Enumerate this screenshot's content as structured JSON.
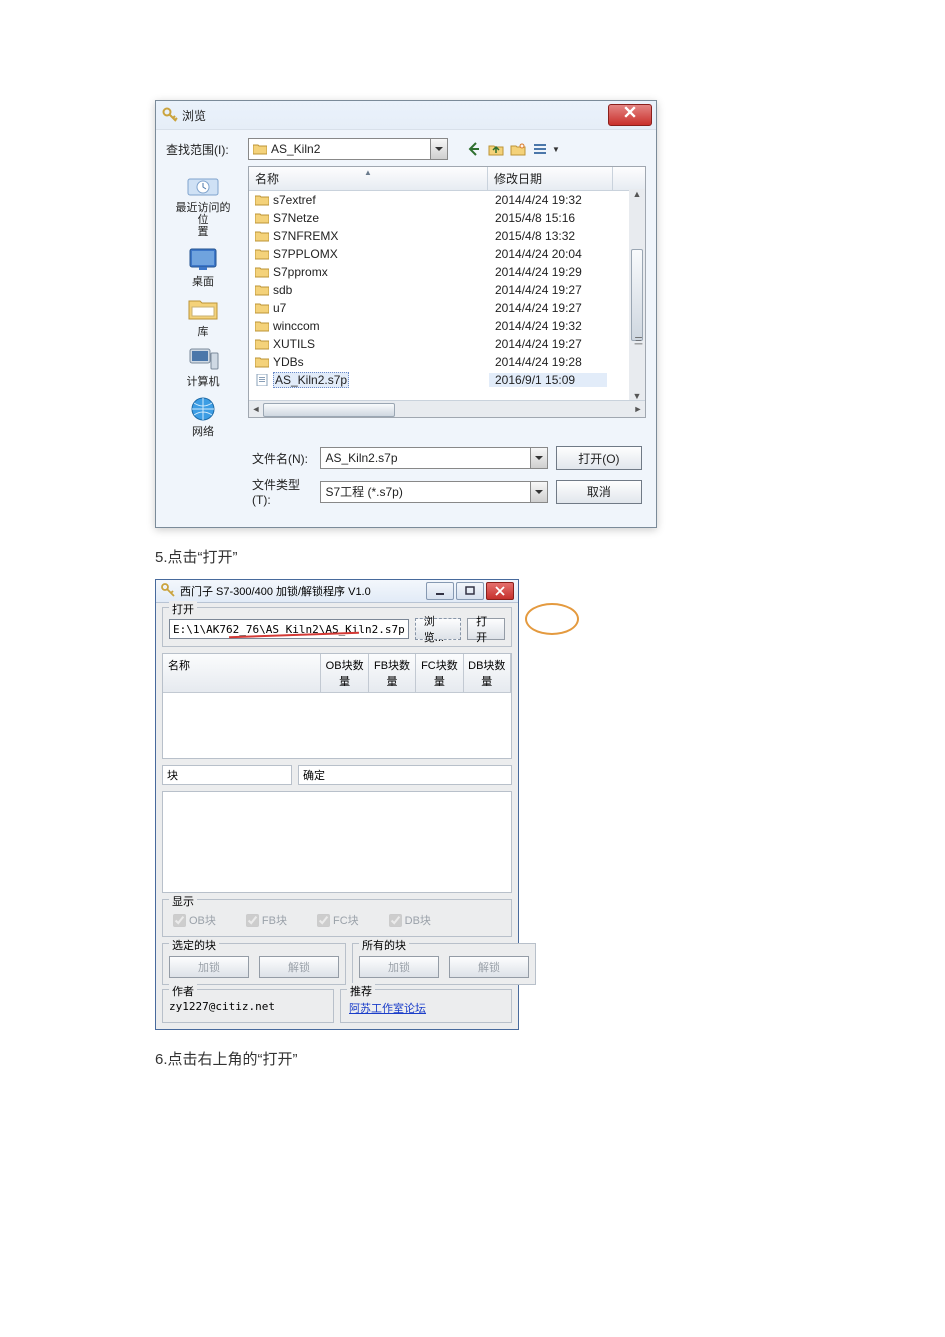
{
  "dialog1": {
    "title": "浏览",
    "look_in_label": "查找范围(I):",
    "look_in_value": "AS_Kiln2",
    "columns": {
      "name": "名称",
      "date": "修改日期"
    },
    "places": [
      {
        "label": "最近访问的位\n置"
      },
      {
        "label": "桌面"
      },
      {
        "label": "库"
      },
      {
        "label": "计算机"
      },
      {
        "label": "网络"
      }
    ],
    "files": [
      {
        "name": "s7extref",
        "date": "2014/4/24 19:32",
        "type": "folder"
      },
      {
        "name": "S7Netze",
        "date": "2015/4/8 15:16",
        "type": "folder"
      },
      {
        "name": "S7NFREMX",
        "date": "2015/4/8 13:32",
        "type": "folder"
      },
      {
        "name": "S7PPLOMX",
        "date": "2014/4/24 20:04",
        "type": "folder"
      },
      {
        "name": "S7ppromx",
        "date": "2014/4/24 19:29",
        "type": "folder"
      },
      {
        "name": "sdb",
        "date": "2014/4/24 19:27",
        "type": "folder"
      },
      {
        "name": "u7",
        "date": "2014/4/24 19:27",
        "type": "folder"
      },
      {
        "name": "winccom",
        "date": "2014/4/24 19:32",
        "type": "folder"
      },
      {
        "name": "XUTILS",
        "date": "2014/4/24 19:27",
        "type": "folder"
      },
      {
        "name": "YDBs",
        "date": "2014/4/24 19:28",
        "type": "folder"
      },
      {
        "name": "AS_Kiln2.s7p",
        "date": "2016/9/1 15:09",
        "type": "file",
        "selected": true
      }
    ],
    "file_name_label": "文件名(N):",
    "file_name_value": "AS_Kiln2.s7p",
    "file_type_label": "文件类型(T):",
    "file_type_value": "S7工程 (*.s7p)",
    "open_btn": "打开(O)",
    "cancel_btn": "取消"
  },
  "step5": "5.点击“打开”",
  "dialog2": {
    "title": "西门子 S7-300/400 加锁/解锁程序 V1.0",
    "open_group": "打开",
    "path_value": "E:\\1\\AK762_76\\AS_Kiln2\\AS_Kiln2.s7p",
    "browse_btn": "浏览...",
    "open_btn": "打开",
    "list_name": "名称",
    "qty_cols": [
      "OB块数量",
      "FB块数量",
      "FC块数量",
      "DB块数量"
    ],
    "kuai_label": "块",
    "kuai_btn": "确定",
    "display_group": "显示",
    "checkboxes": [
      "OB块",
      "FB块",
      "FC块",
      "DB块"
    ],
    "sel_group": "选定的块",
    "all_group": "所有的块",
    "lock_btn": "加锁",
    "unlock_btn": "解锁",
    "author_group": "作者",
    "author_value": "zy1227@citiz.net",
    "recommend_group": "推荐",
    "recommend_link": "阿苏工作室论坛"
  },
  "step6": "6.点击右上角的“打开”"
}
